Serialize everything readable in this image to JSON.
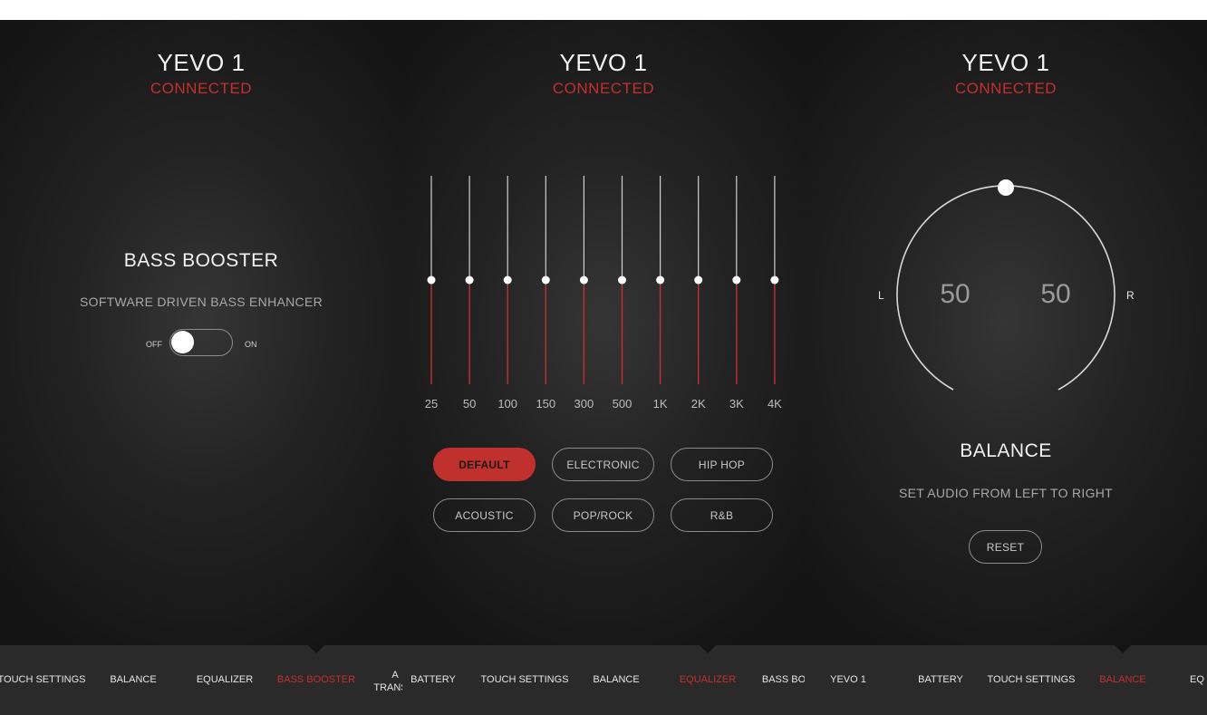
{
  "theme": {
    "accent": "#c62f2f",
    "background": "#1c1c1c",
    "nav_background": "#2a2a2a"
  },
  "panels": [
    {
      "device_name": "YEVO 1",
      "status": "CONNECTED",
      "title": "BASS BOOSTER",
      "subtitle": "SOFTWARE DRIVEN BASS ENHANCER",
      "toggle": {
        "off_label": "OFF",
        "on_label": "ON",
        "state": "off"
      }
    },
    {
      "device_name": "YEVO 1",
      "status": "CONNECTED",
      "equalizer": {
        "bands": [
          "25",
          "50",
          "100",
          "150",
          "300",
          "500",
          "1K",
          "2K",
          "3K",
          "4K"
        ],
        "levels": [
          0.5,
          0.5,
          0.5,
          0.5,
          0.5,
          0.5,
          0.5,
          0.5,
          0.5,
          0.5
        ]
      },
      "presets": [
        "DEFAULT",
        "ELECTRONIC",
        "HIP HOP",
        "ACOUSTIC",
        "POP/ROCK",
        "R&B"
      ],
      "active_preset": "DEFAULT"
    },
    {
      "device_name": "YEVO 1",
      "status": "CONNECTED",
      "balance": {
        "left_label": "L",
        "right_label": "R",
        "left_value": "50",
        "right_value": "50"
      },
      "title": "BALANCE",
      "subtitle": "SET AUDIO FROM LEFT TO RIGHT",
      "reset_label": "RESET"
    }
  ],
  "nav_bars": [
    {
      "items": [
        {
          "label": "TOUCH SETTINGS",
          "active": false
        },
        {
          "label": "BALANCE",
          "active": false
        },
        {
          "label": "EQUALIZER",
          "active": false
        },
        {
          "label": "BASS BOOSTER",
          "active": true
        },
        {
          "label": "A",
          "line2": "TRANS",
          "active": false
        }
      ]
    },
    {
      "items": [
        {
          "label": "BATTERY",
          "active": false
        },
        {
          "label": "TOUCH SETTINGS",
          "active": false
        },
        {
          "label": "BALANCE",
          "active": false
        },
        {
          "label": "EQUALIZER",
          "active": true
        },
        {
          "label": "BASS BO",
          "active": false
        }
      ]
    },
    {
      "items": [
        {
          "label": "YEVO 1",
          "active": false
        },
        {
          "label": "BATTERY",
          "active": false
        },
        {
          "label": "TOUCH SETTINGS",
          "active": false
        },
        {
          "label": "BALANCE",
          "active": true
        },
        {
          "label": "EQ",
          "active": false
        }
      ]
    }
  ]
}
